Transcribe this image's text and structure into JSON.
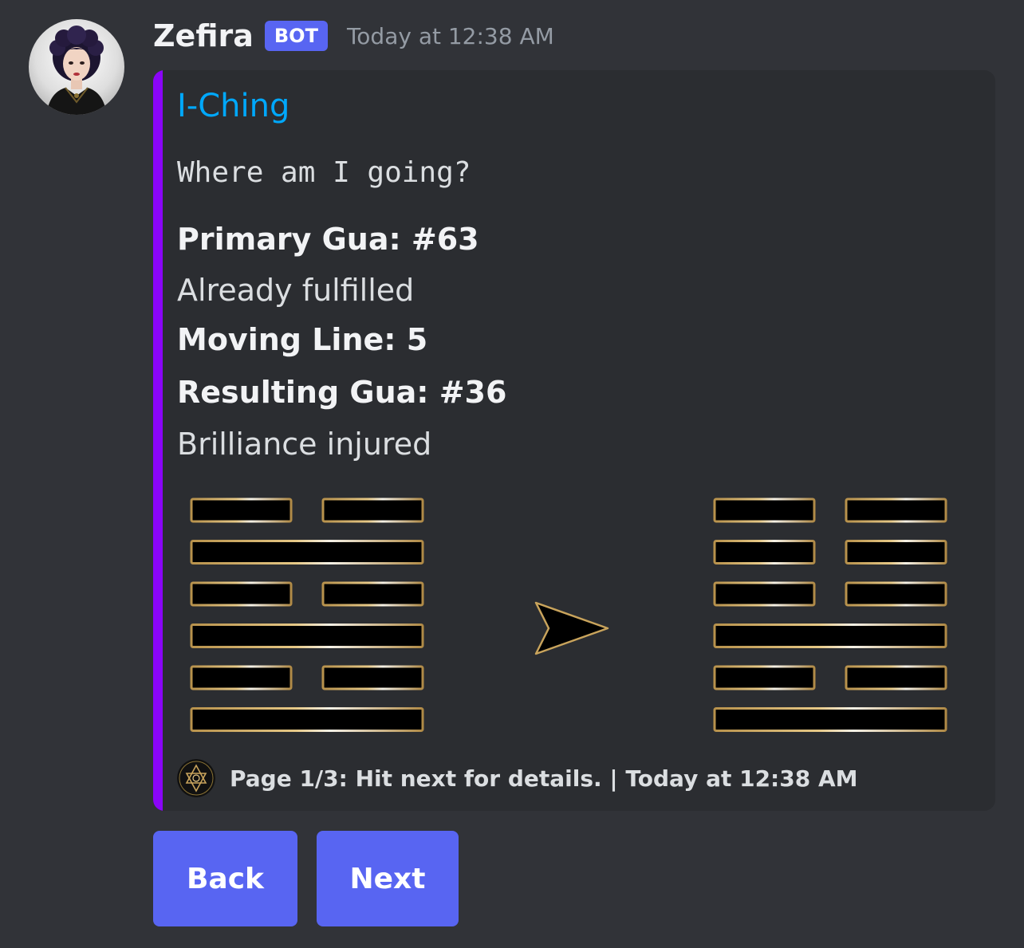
{
  "message": {
    "author": "Zefira",
    "badge": "BOT",
    "timestamp": "Today at 12:38 AM"
  },
  "embed": {
    "accent_color": "#8a05f8",
    "title": "I-Ching",
    "question": "Where am I going?",
    "fields": [
      {
        "label": "Primary Gua: #63",
        "value": "Already fulfilled"
      },
      {
        "label": "Moving Line: 5",
        "value": ""
      },
      {
        "label": "Resulting Gua: #36",
        "value": "Brilliance injured"
      }
    ],
    "image": {
      "primary_hexagram_lines_top_to_bottom": [
        "broken",
        "solid",
        "broken",
        "solid",
        "broken",
        "solid"
      ],
      "resulting_hexagram_lines_top_to_bottom": [
        "broken",
        "broken",
        "broken",
        "solid",
        "broken",
        "solid"
      ],
      "arrow": "arrow-right-icon"
    },
    "footer": {
      "icon": "unicursal-hexagram-icon",
      "text": "Page 1/3: Hit next for details. | Today at 12:38 AM"
    }
  },
  "buttons": {
    "back_label": "Back",
    "next_label": "Next"
  },
  "colors": {
    "background": "#313338",
    "embed_background": "#2b2d31",
    "title_link": "#00a8fc",
    "button": "#5865f2",
    "line_border": "#c9a45c"
  }
}
